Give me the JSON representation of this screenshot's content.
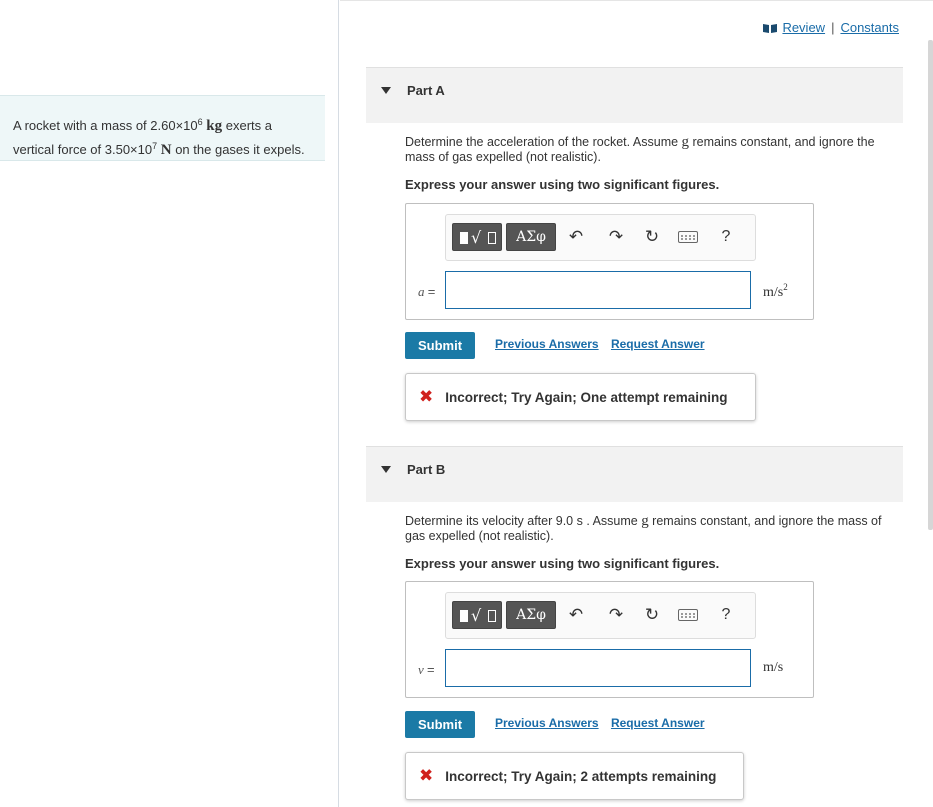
{
  "problem": {
    "text_before_mass": "A rocket with a mass of 2.60×10",
    "mass_exp": "6",
    "mass_unit": "kg",
    "text_mid": " exerts a vertical force of 3.50×10",
    "force_exp": "7",
    "force_unit": "N",
    "text_after": " on the gases it expels."
  },
  "top_links": {
    "review": "Review",
    "separator": "|",
    "constants": "Constants"
  },
  "partA": {
    "title": "Part A",
    "question_pre": "Determine the acceleration of the rocket. Assume ",
    "question_g": "g",
    "question_post": " remains constant, and ignore the mass of gas expelled (not realistic).",
    "instruction": "Express your answer using two significant figures.",
    "variable": "a",
    "equals": "=",
    "input_value": "",
    "unit_base": "m/s",
    "unit_exp": "2",
    "submit": "Submit",
    "previous_answers": "Previous Answers",
    "request_answer": "Request Answer",
    "feedback": "Incorrect; Try Again; One attempt remaining"
  },
  "partB": {
    "title": "Part B",
    "question_pre": "Determine its velocity after 9.0 s . Assume ",
    "question_g": "g",
    "question_post": " remains constant, and ignore the mass of gas expelled (not realistic).",
    "instruction": "Express your answer using two significant figures.",
    "variable": "v",
    "equals": "=",
    "input_value": "",
    "unit_base": "m/s",
    "submit": "Submit",
    "previous_answers": "Previous Answers",
    "request_answer": "Request Answer",
    "feedback": "Incorrect; Try Again; 2 attempts remaining"
  },
  "toolbar": {
    "templates_icon": "templates-icon",
    "greek": "ΑΣφ",
    "undo_icon": "undo-icon",
    "redo_icon": "redo-icon",
    "reset_icon": "reset-icon",
    "keyboard_icon": "keyboard-icon",
    "help": "?"
  },
  "colors": {
    "accent": "#1b7aa6",
    "link": "#1a6ca8",
    "error": "#d0201c",
    "problem_bg": "#eef7f8"
  }
}
